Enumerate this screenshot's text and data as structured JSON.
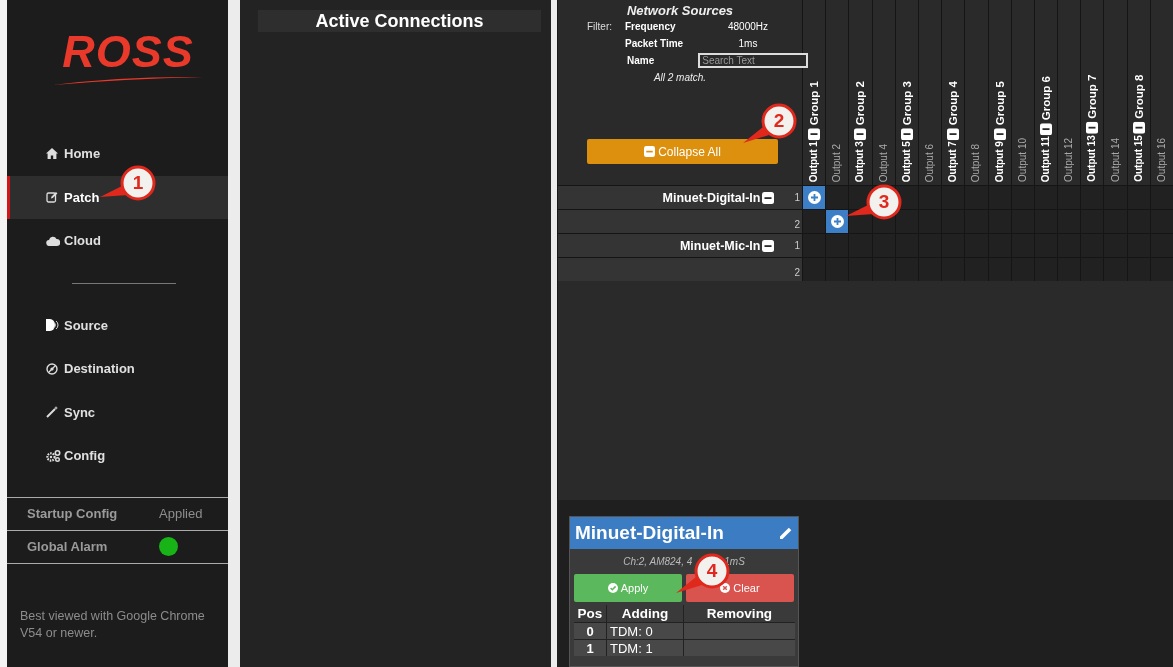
{
  "sidebar": {
    "logo": "ROSS",
    "items": [
      {
        "label": "Home",
        "selected": false
      },
      {
        "label": "Patch",
        "selected": true
      },
      {
        "label": "Cloud",
        "selected": false
      },
      {
        "label": "Source",
        "selected": false
      },
      {
        "label": "Destination",
        "selected": false
      },
      {
        "label": "Sync",
        "selected": false
      },
      {
        "label": "Config",
        "selected": false
      }
    ],
    "status": [
      {
        "label": "Startup Config",
        "kind": "text",
        "value": "Applied"
      },
      {
        "label": "Global Alarm",
        "kind": "dot",
        "color": "#17b317"
      }
    ],
    "footer": "Best viewed with Google Chrome V54 or newer."
  },
  "connections_panel": {
    "title": "Active Connections"
  },
  "matrix": {
    "title": "Network Sources",
    "filter_label": "Filter:",
    "filters": [
      {
        "label": "Frequency",
        "value": "48000Hz"
      },
      {
        "label": "Packet Time",
        "value": "1ms"
      }
    ],
    "name_label": "Name",
    "search": {
      "placeholder": "Search Text"
    },
    "match_text": "All 2 match.",
    "collapse_button": "Collapse All",
    "columns": [
      {
        "output": "Output 1",
        "group": "Group 1",
        "expanded": true
      },
      {
        "output": "Output 2"
      },
      {
        "output": "Output 3",
        "group": "Group 2",
        "expanded": true
      },
      {
        "output": "Output 4"
      },
      {
        "output": "Output 5",
        "group": "Group 3",
        "expanded": true
      },
      {
        "output": "Output 6"
      },
      {
        "output": "Output 7",
        "group": "Group 4",
        "expanded": true
      },
      {
        "output": "Output 8"
      },
      {
        "output": "Output 9",
        "group": "Group 5",
        "expanded": true
      },
      {
        "output": "Output 10"
      },
      {
        "output": "Output 11",
        "group": "Group 6",
        "expanded": true
      },
      {
        "output": "Output 12"
      },
      {
        "output": "Output 13",
        "group": "Group 7",
        "expanded": true
      },
      {
        "output": "Output 14"
      },
      {
        "output": "Output 15",
        "group": "Group 8",
        "expanded": true
      },
      {
        "output": "Output 16"
      }
    ],
    "rows": [
      {
        "source": "Minuet-Digital-In",
        "expanded": true,
        "channel": "1",
        "connected": [
          true,
          false,
          false,
          false,
          false,
          false,
          false,
          false,
          false,
          false,
          false,
          false,
          false,
          false,
          false,
          false
        ]
      },
      {
        "channel": "2",
        "connected": [
          false,
          true,
          false,
          false,
          false,
          false,
          false,
          false,
          false,
          false,
          false,
          false,
          false,
          false,
          false,
          false
        ]
      },
      {
        "source": "Minuet-Mic-In",
        "expanded": true,
        "channel": "1",
        "connected": [
          false,
          false,
          false,
          false,
          false,
          false,
          false,
          false,
          false,
          false,
          false,
          false,
          false,
          false,
          false,
          false
        ]
      },
      {
        "channel": "2",
        "connected": [
          false,
          false,
          false,
          false,
          false,
          false,
          false,
          false,
          false,
          false,
          false,
          false,
          false,
          false,
          false,
          false
        ]
      }
    ]
  },
  "destination_card": {
    "title": "Minuet-Digital-In",
    "subtitle_parts": [
      "Ch:2, AM824, 4",
      "1mS"
    ],
    "buttons": [
      {
        "label": "Apply",
        "kind": "apply"
      },
      {
        "label": "Clear",
        "kind": "clear"
      }
    ],
    "columns": [
      "Pos",
      "Adding",
      "Removing"
    ],
    "rows": [
      [
        "0",
        "TDM: 0",
        ""
      ],
      [
        "1",
        "TDM: 1",
        ""
      ]
    ]
  },
  "callouts": [
    "1",
    "2",
    "3",
    "4"
  ]
}
